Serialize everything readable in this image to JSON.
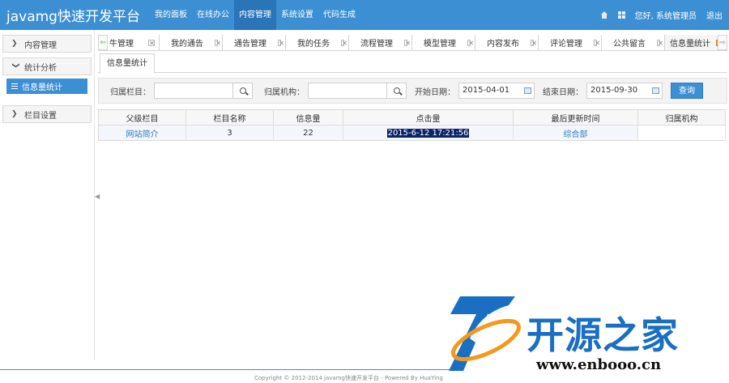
{
  "header": {
    "brand": "javamg快速开发平台",
    "nav": [
      {
        "label": "我的面板",
        "active": false
      },
      {
        "label": "在线办公",
        "active": false
      },
      {
        "label": "内容管理",
        "active": true
      },
      {
        "label": "系统设置",
        "active": false
      },
      {
        "label": "代码生成",
        "active": false
      }
    ],
    "greeting": "您好, 系统管理员",
    "logout": "退出",
    "icons": [
      "home-icon",
      "grid-icon"
    ]
  },
  "sidebar": {
    "groups": [
      {
        "label": "内容管理",
        "expanded": false
      },
      {
        "label": "统计分析",
        "expanded": true,
        "children": [
          {
            "label": "信息量统计",
            "selected": true
          }
        ]
      },
      {
        "label": "栏目设置",
        "expanded": false
      }
    ]
  },
  "tabs": [
    {
      "label": "牛管理",
      "active": false
    },
    {
      "label": "我的通告",
      "active": false
    },
    {
      "label": "通告管理",
      "active": false
    },
    {
      "label": "我的任务",
      "active": false
    },
    {
      "label": "流程管理",
      "active": false
    },
    {
      "label": "模型管理",
      "active": false
    },
    {
      "label": "内容发布",
      "active": false
    },
    {
      "label": "评论管理",
      "active": false
    },
    {
      "label": "公共留言",
      "active": false
    },
    {
      "label": "信息量统计",
      "active": true
    }
  ],
  "subtab": "信息量统计",
  "filter": {
    "category_label": "归属栏目：",
    "category_value": "",
    "org_label": "归属机构：",
    "org_value": "",
    "start_label": "开始日期：",
    "start_value": "2015-04-01",
    "end_label": "结束日期：",
    "end_value": "2015-09-30",
    "query_label": "查询"
  },
  "table": {
    "columns": [
      "父级栏目",
      "栏目名称",
      "信息量",
      "点击量",
      "最后更新时间",
      "归属机构"
    ],
    "rows": [
      [
        "网站简介",
        "3",
        "22",
        "2015-6-12 17:21:56",
        "综合部",
        ""
      ]
    ]
  },
  "footer": {
    "copyright": "Copyright © 2012-2014 javamg快速开发平台 - Powered By HuaYing"
  },
  "watermark": {
    "text": "开源之家",
    "url": "www.enbooo.cn"
  },
  "colors": {
    "primary": "#3d8fd4",
    "selection": "#0a246a",
    "active_close": "#f0a040"
  }
}
